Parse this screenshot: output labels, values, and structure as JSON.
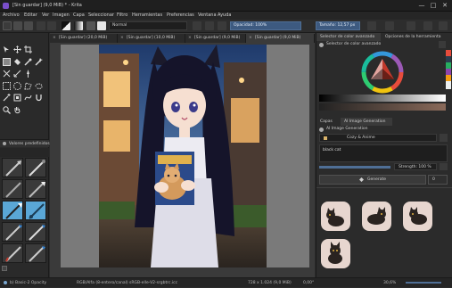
{
  "window": {
    "title": "[Sin guardar] (9,0 MiB) * - Krita",
    "minimize_glyph": "—",
    "maximize_glyph": "□",
    "close_glyph": "✕"
  },
  "menu": {
    "items": [
      "Archivo",
      "Editar",
      "Ver",
      "Imagen",
      "Capa",
      "Seleccionar",
      "Filtro",
      "Herramientas",
      "Preferencias",
      "Ventana",
      "Ayuda"
    ]
  },
  "toolbar": {
    "blend_mode": "Normal",
    "opacity": "Opacidad: 100%",
    "size": "Tamaño: 12,57 px"
  },
  "tabs": [
    {
      "close": "×",
      "label": "[Sin guardar] (20,0 MiB)"
    },
    {
      "close": "×",
      "label": "[Sin guardar] (10,0 MiB)"
    },
    {
      "close": "×",
      "label": "[Sin guardar] (9,0 MiB)"
    },
    {
      "close": "×",
      "label": "[Sin guardar] (9,0 MiB)"
    }
  ],
  "brush_presets": {
    "header": "Valores predefinidos..."
  },
  "color_panel": {
    "tabs": [
      "Selector de color avanzado",
      "Opciones de la herramienta"
    ],
    "section_title": "Selector de color avanzado"
  },
  "ai_panel": {
    "tabs": [
      "Capas",
      "AI Image Generation"
    ],
    "title": "AI Image Generation",
    "workspace": "Cozy & Anime",
    "prompt": "black cat",
    "strength": "Strength: 100 %",
    "generate_label": "Generate",
    "count": "0"
  },
  "status": {
    "left": "b) Basic-2 Opacity",
    "doc_info": "RGB/Alfa (8-entero/canal) sRGB-elle-V2-srgbtrc.icc",
    "size": "728 x 1.024 (9,0 MiB)",
    "rotation": "0,00°",
    "zoom": "30,6%"
  },
  "colors": {
    "accent": "#3d5a80",
    "selected_preset": "#5aa7d6",
    "app_bg": "#2b2b2b",
    "canvas_bg": "#7a7a7a"
  }
}
